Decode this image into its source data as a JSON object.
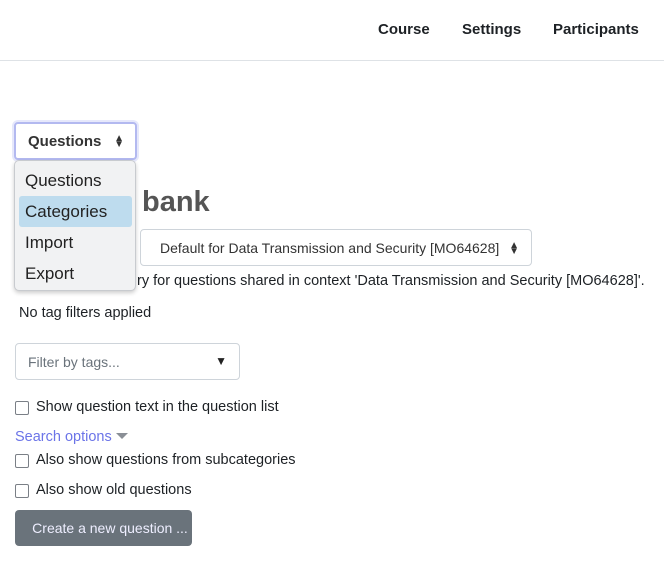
{
  "nav": {
    "course": "Course",
    "settings": "Settings",
    "participants": "Participants"
  },
  "navigation_select": {
    "value": "Questions",
    "options": [
      "Questions",
      "Categories",
      "Import",
      "Export"
    ],
    "highlighted": "Categories"
  },
  "heading_visible": "bank",
  "category_select": {
    "value": "Default for Data Transmission and Security [MO64628]"
  },
  "category_info_visible": "ry for questions shared in context 'Data Transmission and Security [MO64628]'.",
  "tag_status": "No tag filters applied",
  "tag_filter": {
    "placeholder": "Filter by tags..."
  },
  "show_question_text": {
    "label": "Show question text in the question list",
    "checked": false
  },
  "search_options": "Search options",
  "subcategories": {
    "label": "Also show questions from subcategories",
    "checked": false
  },
  "old_questions": {
    "label": "Also show old questions",
    "checked": false
  },
  "create_button": "Create a new question ...",
  "colors": {
    "link": "#6b74e8",
    "highlight": "#bedcee",
    "button": "#6a737b"
  }
}
